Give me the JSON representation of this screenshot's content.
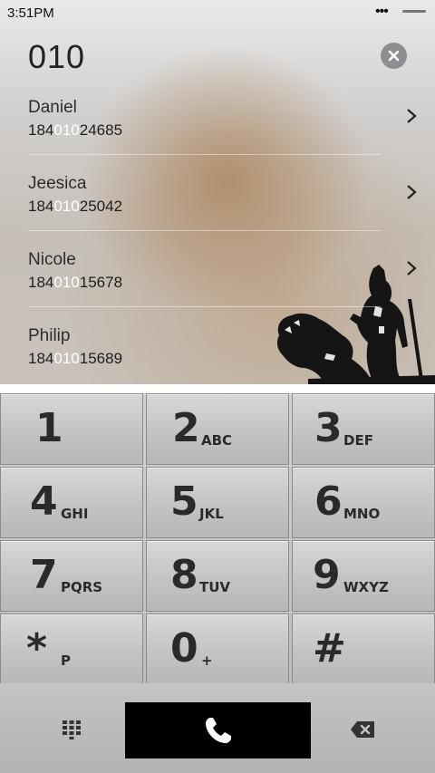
{
  "status": {
    "time": "3:51PM",
    "dots": "•••"
  },
  "dialer": {
    "input": "010"
  },
  "contacts": [
    {
      "name": "Daniel",
      "num_pre": "184",
      "num_match": "010",
      "num_post": "24685"
    },
    {
      "name": "Jeesica",
      "num_pre": "184",
      "num_match": "010",
      "num_post": "25042"
    },
    {
      "name": "Nicole",
      "num_pre": "184",
      "num_match": "010",
      "num_post": "15678"
    },
    {
      "name": "Philip",
      "num_pre": "184",
      "num_match": "010",
      "num_post": "15689"
    }
  ],
  "keys": [
    {
      "digit": "1",
      "letters": ""
    },
    {
      "digit": "2",
      "letters": "ABC"
    },
    {
      "digit": "3",
      "letters": "DEF"
    },
    {
      "digit": "4",
      "letters": "GHI"
    },
    {
      "digit": "5",
      "letters": "JKL"
    },
    {
      "digit": "6",
      "letters": "MNO"
    },
    {
      "digit": "7",
      "letters": "PQRS"
    },
    {
      "digit": "8",
      "letters": "TUV"
    },
    {
      "digit": "9",
      "letters": "WXYZ"
    },
    {
      "digit": "*",
      "letters": "P"
    },
    {
      "digit": "0",
      "letters": "+"
    },
    {
      "digit": "#",
      "letters": ""
    }
  ],
  "icons": {
    "clear": "close-icon",
    "chevron": "chevron-right-icon",
    "keypad": "keypad-grid-icon",
    "call": "phone-icon",
    "delete": "backspace-icon"
  },
  "colors": {
    "highlight": "#ffffff",
    "call_button": "#000000"
  }
}
